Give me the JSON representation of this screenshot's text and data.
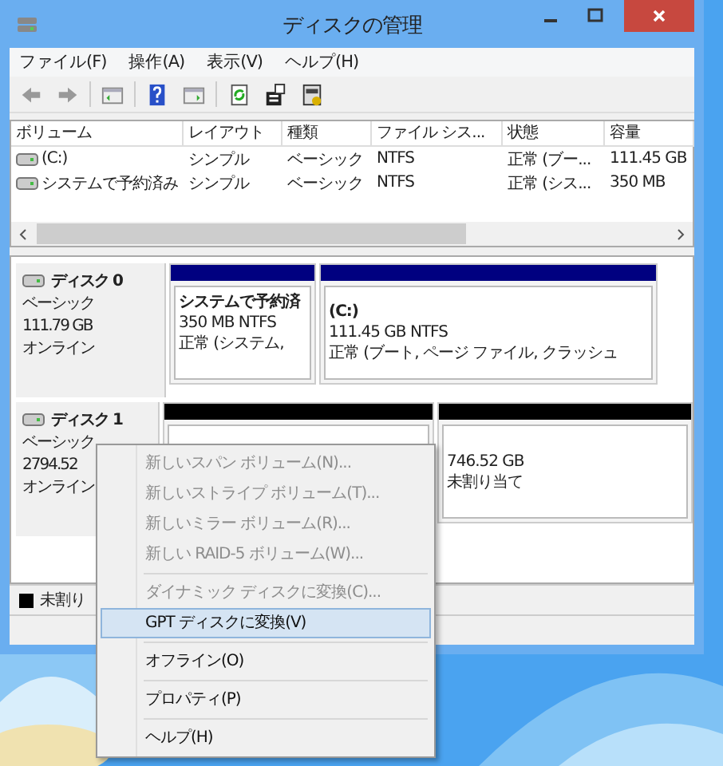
{
  "window": {
    "title": "ディスクの管理"
  },
  "menu_bar": [
    "ファイル(F)",
    "操作(A)",
    "表示(V)",
    "ヘルプ(H)"
  ],
  "volume_table": {
    "columns": [
      "ボリューム",
      "レイアウト",
      "種類",
      "ファイル シス...",
      "状態",
      "容量"
    ],
    "rows": [
      [
        "(C:)",
        "シンプル",
        "ベーシック",
        "NTFS",
        "正常 (ブー...",
        "111.45 GB"
      ],
      [
        "システムで予約済み",
        "シンプル",
        "ベーシック",
        "NTFS",
        "正常 (シス...",
        "350 MB"
      ]
    ]
  },
  "disks": [
    {
      "name": "ディスク 0",
      "lines": [
        "ベーシック",
        "111.79 GB",
        "オンライン"
      ],
      "partitions": [
        {
          "kind": "primary",
          "lines": [
            "システムで予約済",
            "350 MB NTFS",
            "正常 (システム,"
          ]
        },
        {
          "kind": "primary",
          "lines": [
            "(C:)",
            "111.45 GB NTFS",
            "正常 (ブート, ページ ファイル, クラッシュ"
          ]
        }
      ]
    },
    {
      "name": "ディスク 1",
      "lines": [
        "ベーシック",
        "2794.52",
        "オンライン"
      ],
      "partitions": [
        {
          "kind": "unallocated"
        },
        {
          "kind": "unallocated",
          "lines": [
            "746.52 GB",
            "未割り当て"
          ]
        }
      ]
    }
  ],
  "legend": [
    {
      "label": "未割り"
    }
  ],
  "context_menu": [
    {
      "kind": "item",
      "label": "新しいスパン ボリューム(N)...",
      "disabled": true,
      "selected": false
    },
    {
      "kind": "item",
      "label": "新しいストライプ ボリューム(T)...",
      "disabled": true,
      "selected": false
    },
    {
      "kind": "item",
      "label": "新しいミラー ボリューム(R)...",
      "disabled": true,
      "selected": false
    },
    {
      "kind": "item",
      "label": "新しい RAID-5 ボリューム(W)...",
      "disabled": true,
      "selected": false
    },
    {
      "kind": "separator"
    },
    {
      "kind": "item",
      "label": "ダイナミック ディスクに変換(C)...",
      "disabled": true,
      "selected": false
    },
    {
      "kind": "item",
      "label": "GPT ディスクに変換(V)",
      "disabled": false,
      "selected": true
    },
    {
      "kind": "separator"
    },
    {
      "kind": "item",
      "label": "オフライン(O)",
      "disabled": false,
      "selected": false
    },
    {
      "kind": "separator"
    },
    {
      "kind": "item",
      "label": "プロパティ(P)",
      "disabled": false,
      "selected": false
    },
    {
      "kind": "separator"
    },
    {
      "kind": "item",
      "label": "ヘルプ(H)",
      "disabled": false,
      "selected": false
    }
  ]
}
